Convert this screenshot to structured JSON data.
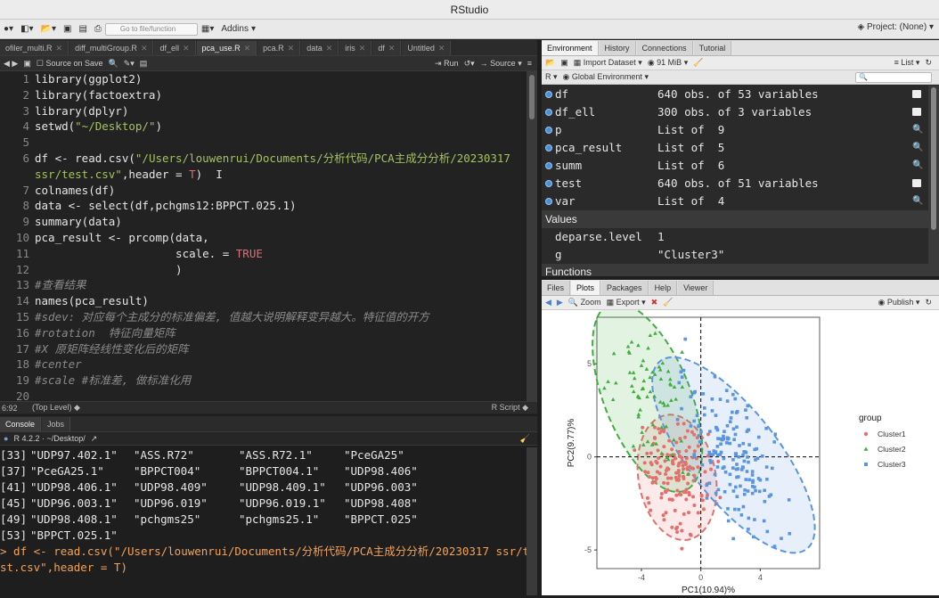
{
  "window": {
    "title": "RStudio"
  },
  "toolbar": {
    "goto_placeholder": "Go to file/function",
    "addins": "Addins",
    "project": "Project: (None)"
  },
  "editor": {
    "tabs": [
      {
        "label": "ofiler_multi.R"
      },
      {
        "label": "diff_multiGroup.R"
      },
      {
        "label": "df_ell"
      },
      {
        "label": "pca_use.R",
        "active": true
      },
      {
        "label": "pca.R"
      },
      {
        "label": "data"
      },
      {
        "label": "iris"
      },
      {
        "label": "df"
      },
      {
        "label": "Untitled"
      }
    ],
    "tools": {
      "source_on_save": "Source on Save",
      "run": "Run",
      "source": "Source"
    },
    "line_numbers": [
      "1",
      "2",
      "3",
      "4",
      "5",
      "6",
      "",
      "7",
      "8",
      "9",
      "10",
      "11",
      "12",
      "13",
      "14",
      "15",
      "16",
      "17",
      "18",
      "19",
      "20"
    ],
    "lines": [
      [
        {
          "t": "library(ggplot2)",
          "c": ""
        }
      ],
      [
        {
          "t": "library(factoextra)",
          "c": ""
        }
      ],
      [
        {
          "t": "library(dplyr)",
          "c": ""
        }
      ],
      [
        {
          "t": "setwd(",
          "c": ""
        },
        {
          "t": "\"~/Desktop/\"",
          "c": "str"
        },
        {
          "t": ")",
          "c": ""
        }
      ],
      [
        {
          "t": "",
          "c": ""
        }
      ],
      [
        {
          "t": "df <- read.csv(",
          "c": ""
        },
        {
          "t": "\"/Users/louwenrui/Documents/分析代码/PCA主成分分析/20230317",
          "c": "str"
        }
      ],
      [
        {
          "t": "ssr/test.csv\"",
          "c": "str"
        },
        {
          "t": ",header = ",
          "c": ""
        },
        {
          "t": "T",
          "c": "kw"
        },
        {
          "t": ")  I",
          "c": ""
        }
      ],
      [
        {
          "t": "colnames(df)",
          "c": ""
        }
      ],
      [
        {
          "t": "data <- select(df,pchgms12:BPPCT.025.1)",
          "c": ""
        }
      ],
      [
        {
          "t": "summary(data)",
          "c": ""
        }
      ],
      [
        {
          "t": "pca_result <- prcomp(data,",
          "c": ""
        }
      ],
      [
        {
          "t": "                     scale. = ",
          "c": ""
        },
        {
          "t": "TRUE",
          "c": "kw"
        }
      ],
      [
        {
          "t": "                     )",
          "c": ""
        }
      ],
      [
        {
          "t": "#查看结果",
          "c": "cm"
        }
      ],
      [
        {
          "t": "names(pca_result)",
          "c": ""
        }
      ],
      [
        {
          "t": "#sdev: 对应每个主成分的标准偏差, 值越大说明解释变异越大。特征值的开方",
          "c": "cm"
        }
      ],
      [
        {
          "t": "#rotation  特征向量矩阵",
          "c": "cm"
        }
      ],
      [
        {
          "t": "#X 原矩阵经线性变化后的矩阵",
          "c": "cm"
        }
      ],
      [
        {
          "t": "#center",
          "c": "cm"
        }
      ],
      [
        {
          "t": "#scale #标准差, 做标准化用",
          "c": "cm"
        }
      ],
      [
        {
          "t": "",
          "c": ""
        }
      ]
    ],
    "status": {
      "pos": "6:92",
      "scope": "(Top Level)",
      "type": "R Script"
    }
  },
  "console": {
    "tabs": [
      {
        "label": "Console",
        "active": true
      },
      {
        "label": "Jobs"
      }
    ],
    "path": "R 4.2.2 · ~/Desktop/",
    "rows": [
      [
        "[33]",
        "\"UDP97.402.1\"",
        "\"ASS.R72\"",
        "\"ASS.R72.1\"",
        "\"PceGA25\""
      ],
      [
        "[37]",
        "\"PceGA25.1\"",
        "\"BPPCT004\"",
        "\"BPPCT004.1\"",
        "\"UDP98.406\""
      ],
      [
        "[41]",
        "\"UDP98.406.1\"",
        "\"UDP98.409\"",
        "\"UDP98.409.1\"",
        "\"UDP96.003\""
      ],
      [
        "[45]",
        "\"UDP96.003.1\"",
        "\"UDP96.019\"",
        "\"UDP96.019.1\"",
        "\"UDP98.408\""
      ],
      [
        "[49]",
        "\"UDP98.408.1\"",
        "\"pchgms25\"",
        "\"pchgms25.1\"",
        "\"BPPCT.025\""
      ],
      [
        "[53]",
        "\"BPPCT.025.1\"",
        "",
        "",
        ""
      ]
    ],
    "cmd1": "> df <- read.csv(\"/Users/louwenrui/Documents/分析代码/PCA主成分分析/20230317 ssr/te",
    "cmd2": "st.csv\",header = T)"
  },
  "environment": {
    "tabs": [
      {
        "label": "Environment",
        "active": true
      },
      {
        "label": "History"
      },
      {
        "label": "Connections"
      },
      {
        "label": "Tutorial"
      }
    ],
    "tools": {
      "import": "Import Dataset",
      "mem": "91 MiB",
      "list": "List",
      "lang": "R",
      "scope": "Global Environment"
    },
    "data": [
      {
        "name": "df",
        "value": "640 obs. of 53 variables",
        "icon": "grid"
      },
      {
        "name": "df_ell",
        "value": "300 obs. of 3 variables",
        "icon": "grid"
      },
      {
        "name": "p",
        "value": "List of  9",
        "icon": "mag"
      },
      {
        "name": "pca_result",
        "value": "List of  5",
        "icon": "mag"
      },
      {
        "name": "summ",
        "value": "List of  6",
        "icon": "mag"
      },
      {
        "name": "test",
        "value": "640 obs. of 51 variables",
        "icon": "grid"
      },
      {
        "name": "var",
        "value": "List of  4",
        "icon": "mag"
      }
    ],
    "values_header": "Values",
    "values": [
      {
        "name": "deparse.level",
        "value": "1"
      },
      {
        "name": "g",
        "value": "\"Cluster3\""
      }
    ],
    "functions_header": "Functions"
  },
  "plots": {
    "tabs": [
      {
        "label": "Files"
      },
      {
        "label": "Plots",
        "active": true
      },
      {
        "label": "Packages"
      },
      {
        "label": "Help"
      },
      {
        "label": "Viewer"
      }
    ],
    "tools": {
      "zoom": "Zoom",
      "export": "Export",
      "publish": "Publish"
    }
  },
  "chart_data": {
    "type": "scatter",
    "xlabel": "PC1(10.94)%",
    "ylabel": "PC2(9.77)%",
    "xlim": [
      -7,
      8
    ],
    "ylim": [
      -6,
      7.5
    ],
    "xticks": [
      -4,
      0,
      4
    ],
    "yticks": [
      -5,
      0,
      5
    ],
    "legend_title": "group",
    "legend_position": "right",
    "series": [
      {
        "name": "Cluster1",
        "color": "#e2716d",
        "shape": "circle",
        "center": [
          -1.6,
          -1.1
        ],
        "ellipse": {
          "cx": -1.6,
          "cy": -1.1,
          "rx": 2.6,
          "ry": 3.4,
          "angle": -10
        }
      },
      {
        "name": "Cluster2",
        "color": "#3fae3f",
        "shape": "triangle",
        "center": [
          -4.2,
          3.0
        ],
        "ellipse": {
          "cx": -3.6,
          "cy": 3.2,
          "rx": 2.9,
          "ry": 5.4,
          "angle": -22
        }
      },
      {
        "name": "Cluster3",
        "color": "#5b95dd",
        "shape": "square",
        "center": [
          2.8,
          1.6
        ],
        "ellipse": {
          "cx": 2.2,
          "cy": 0.1,
          "rx": 3.0,
          "ry": 6.4,
          "angle": -38
        }
      }
    ]
  }
}
